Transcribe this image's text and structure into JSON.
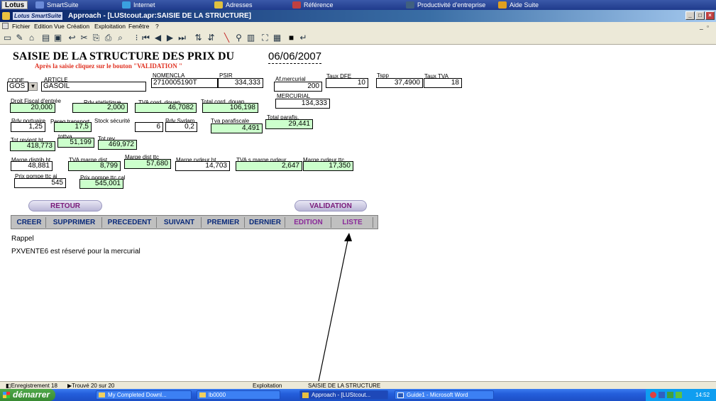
{
  "suite": {
    "lotus": "Lotus",
    "items": [
      "SmartSuite",
      "Internet",
      "Adresses",
      "Référence",
      "Productivité d'entreprise",
      "Aide Suite"
    ]
  },
  "window": {
    "brand": "Lotus SmartSuite",
    "title": "Approach - [LUStcout.apr:SAISIE DE LA STRUCTURE]"
  },
  "menu": [
    "Fichier",
    "Edition",
    "Vue",
    "Création",
    "Exploitation",
    "Fenêtre",
    "?"
  ],
  "form": {
    "heading": "SAISIE DE LA STRUCTURE DES PRIX DU",
    "date": "06/06/2007",
    "instruction": "Après la saisie cliquez sur le bouton  \"VALIDATION \"",
    "labels": {
      "code": "CODE",
      "article": "ARTICLE",
      "nomencla": "NOMENCLA",
      "psir": "PSIR",
      "af_mercurial": "Af.mercurial",
      "taux_dfe": "Taux DFE",
      "tspp": "Tspp",
      "taux_tva": "Taux TVA",
      "droit_fiscal": "Droit Fiscal d'entrée",
      "rdv_stat": "Rdv statistique",
      "tva_cord": "TVA cord. douan.",
      "total_cord": "Total cord. douan.",
      "mercurial": "MERCURIAL",
      "rdv_port": "Rdv portuaire",
      "pereq": "Pereq transport",
      "stock": "Stock  sécurité",
      "rdv_sydam": "Rdv Sydam",
      "tva_parafiscale": "Tva parafiscale",
      "total_parafis": "Total parafis.",
      "tot_revient": "Tot.revient ht",
      "tottva": "tottva",
      "tot_rev": "Tot.rev.",
      "marge_distrib": "Marge distrib ht",
      "tva_marge_dist": "TVA marge  dist",
      "marge_dist_ttc": "Marge dist ttc",
      "marge_rvdeur_ht": "Marge rvdeur ht",
      "tva_s_marge": "TVA s marge rvdeur",
      "marge_rvdeur_ttc": "Marge rvdeur ttc",
      "prix_pompe_aj": "Prix pompe ttc aj",
      "prix_pompe_cal": "Prix pompe ttc cal"
    },
    "values": {
      "code": "GOS",
      "article": "GASOIL",
      "nomencla": "2710005190T",
      "psir": "334,333",
      "af_mercurial": "200",
      "taux_dfe": "10",
      "tspp": "37,4900",
      "taux_tva": "18",
      "droit_fiscal": "20,000",
      "rdv_stat": "2,000",
      "tva_cord": "46,7082",
      "total_cord": "106,198",
      "mercurial": "134,333",
      "rdv_port": "1,25",
      "pereq": "17,5",
      "stock": "6",
      "rdv_sydam": "0,2",
      "tva_parafiscale": "4,491",
      "total_parafis": "29,441",
      "tot_revient": "418,773",
      "tottva": "51,199",
      "tot_rev": "469,972",
      "marge_distrib": "48,881",
      "tva_marge_dist": "8,799",
      "marge_dist_ttc": "57,680",
      "marge_rvdeur_ht": "14,703",
      "tva_s_marge": "2,647",
      "marge_rvdeur_ttc": "17,350",
      "prix_pompe_aj": "545",
      "prix_pompe_cal": "545,001"
    },
    "buttons": {
      "retour": "RETOUR",
      "validation": "VALIDATION"
    },
    "nav": [
      "CREER",
      "SUPPRIMER",
      "PRECEDENT",
      "SUIVANT",
      "PREMIER",
      "DERNIER",
      "EDITION",
      "LISTE"
    ],
    "rappel": "Rappel",
    "note": "PXVENTE6 est réservé pour la mercurial"
  },
  "status": {
    "record": "Enregistrement 18",
    "found": "Trouvé 20 sur 20",
    "mode": "Exploitation",
    "form": "SAISIE DE LA STRUCTURE"
  },
  "taskbar": {
    "start": "démarrer",
    "tasks": [
      "My Completed Downl...",
      "lb0000",
      "Approach - [LUStcout...",
      "Guide1 - Microsoft Word"
    ],
    "time": "14:52"
  }
}
